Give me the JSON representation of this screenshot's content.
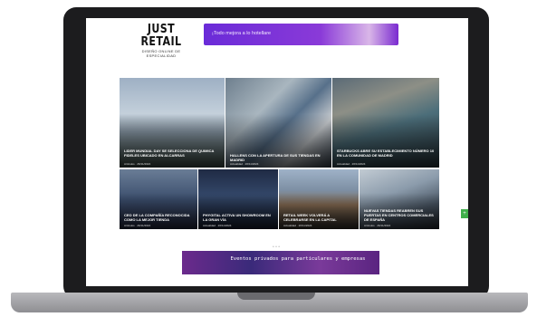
{
  "site": {
    "logo_title": "JUST RETAIL",
    "logo_tagline": "DISEÑO ONLINE DE ESPECIALIDAD",
    "top_banner_text": "¡Todo mejora a lo hotellare"
  },
  "articles": [
    {
      "title": "LIDER MUNDIAL DAY SE SELECCIONA DE QUIMICA FIDELES UBICADO EN ALCARRAS",
      "meta": "Artículos · 26/11/2024"
    },
    {
      "title": "HALLENS CON LA APERTURA DE SUS TIENDAS EN MADRID",
      "meta": "Actualidad · 26/11/2024"
    },
    {
      "title": "STARBUCKS ABRE SU ESTABLECIMIENTO NÚMERO 10 EN LA COMUNIDAD DE MADRID",
      "meta": "Actualidad · 26/11/2024"
    },
    {
      "title": "CEO DE LA COMPAÑÍA RECONOCIDA COMO LA MEJOR TIENDA",
      "meta": "Artículos · 26/11/2024"
    },
    {
      "title": "PHYGITAL ACTIVA UN SHOWROOM EN LA GRAN VÍA",
      "meta": "Actualidad · 26/11/2024"
    },
    {
      "title": "RETAIL WEEK VOLVERÁ A CELEBRARSE EN LA CAPITAL",
      "meta": "Actualidad · 26/11/2024"
    },
    {
      "title": "NUEVAS TIENDAS REABREN SUS PUERTAS EN CENTROS COMERCIALES DE ESPAÑA",
      "meta": "Artículos · 26/11/2024"
    }
  ],
  "side_button_icon": "plus-icon",
  "side_button_label": "+",
  "bottom_banner_text": "Eventos privados para particulares y empresas",
  "colors": {
    "laptop_frame": "#1c1c1e",
    "banner_purple": "#6a2bd8",
    "side_button": "#3fae4a"
  }
}
